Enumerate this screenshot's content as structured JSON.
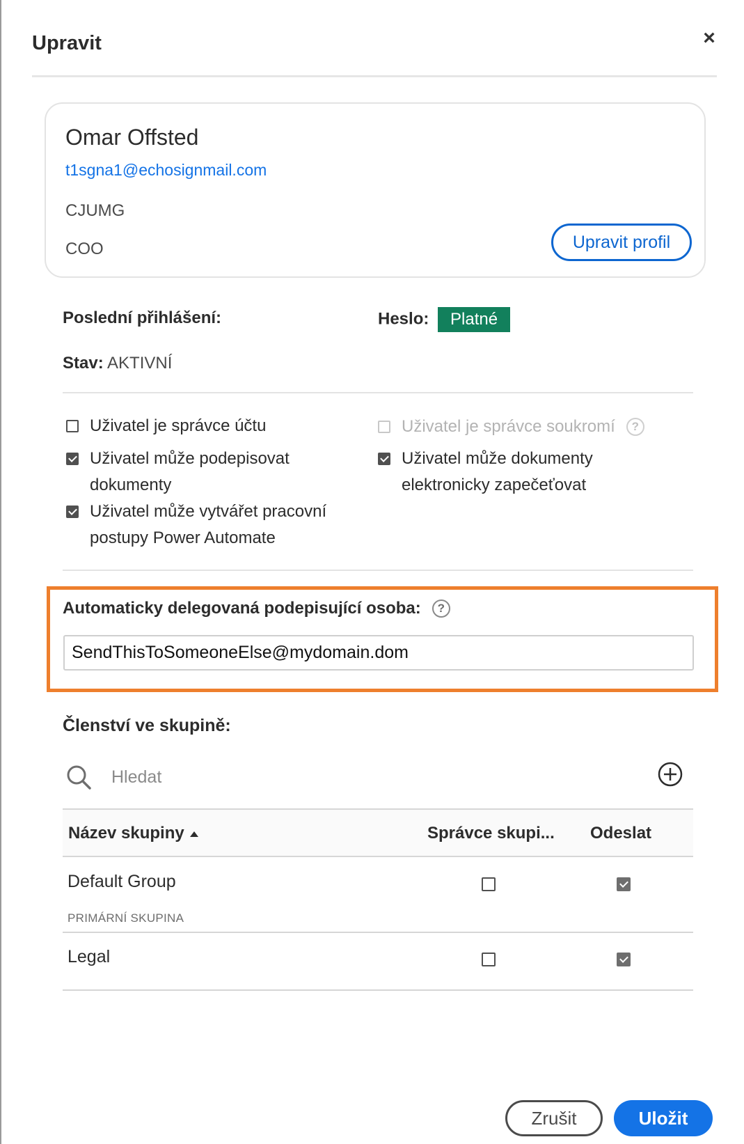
{
  "dialog": {
    "title": "Upravit",
    "close_icon": "close-icon"
  },
  "profile": {
    "name": "Omar Offsted",
    "email": "t1sgna1@echosignmail.com",
    "company": "CJUMG",
    "role": "COO",
    "edit_button": "Upravit profil"
  },
  "info": {
    "last_login_label": "Poslední přihlášení:",
    "password_label": "Heslo:",
    "password_status": "Platné",
    "status_label": "Stav:",
    "status_value": "AKTIVNÍ"
  },
  "permissions": [
    {
      "label": "Uživatel je správce účtu",
      "checked": false,
      "disabled": false
    },
    {
      "label": "Uživatel je správce soukromí",
      "checked": false,
      "disabled": true
    },
    {
      "label": "Uživatel může podepisovat dokumenty",
      "checked": true,
      "disabled": false
    },
    {
      "label": "Uživatel může dokumenty elektronicky zapečeťovat",
      "checked": true,
      "disabled": false
    },
    {
      "label": "Uživatel může vytvářet pracovní postupy Power Automate",
      "checked": true,
      "disabled": false
    }
  ],
  "delegate": {
    "label": "Automaticky delegovaná podepisující osoba:",
    "value": "SendThisToSomeoneElse@mydomain.dom"
  },
  "groups": {
    "title": "Členství ve skupině:",
    "search_placeholder": "Hledat",
    "columns": {
      "name": "Název skupiny",
      "admin": "Správce skupi...",
      "send": "Odeslat"
    },
    "rows": [
      {
        "name": "Default Group",
        "subtitle": "PRIMÁRNÍ SKUPINA",
        "admin": false,
        "send": true
      },
      {
        "name": "Legal",
        "subtitle": "",
        "admin": false,
        "send": true
      }
    ]
  },
  "footer": {
    "cancel": "Zrušit",
    "save": "Uložit"
  },
  "colors": {
    "accent": "#1473e6",
    "success": "#12805c",
    "highlight": "#ee7f2d"
  }
}
